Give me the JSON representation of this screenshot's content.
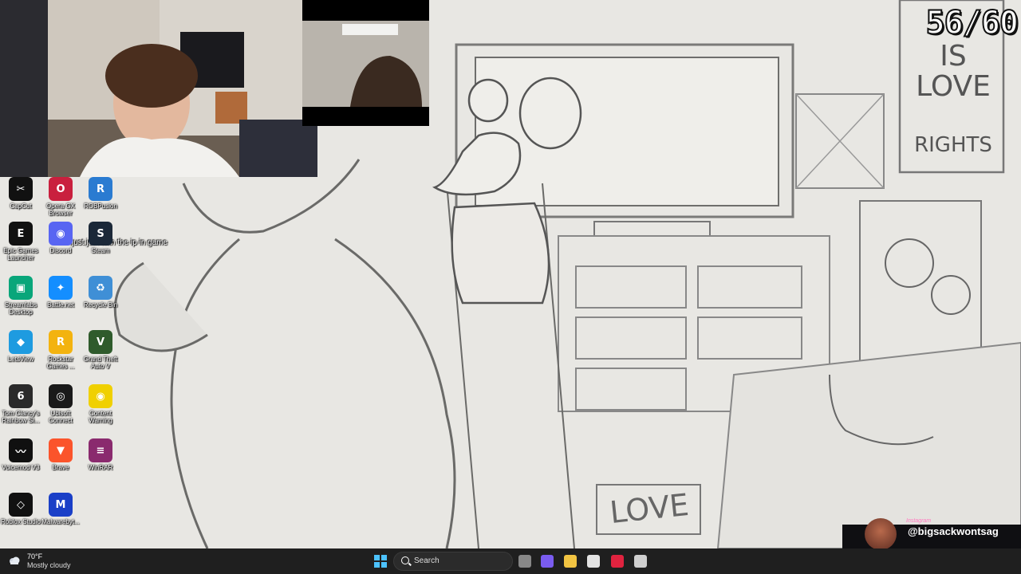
{
  "stream": {
    "counter": "56/60"
  },
  "chat": {
    "message": "just join with the ip in game"
  },
  "drawing": {
    "poster_lines": [
      "IS",
      "LOVE",
      "RIGHTS"
    ],
    "sign_text": "LOVE"
  },
  "desktop": {
    "icons": [
      {
        "label": "CapCut",
        "icon": "capcut-icon",
        "color": "#111111",
        "glyph": "✂"
      },
      {
        "label": "Opera GX Browser",
        "icon": "opera-gx-icon",
        "color": "#c9203e",
        "glyph": "O"
      },
      {
        "label": "ROBPusion",
        "icon": "robpusion-icon",
        "color": "#2a7bd1",
        "glyph": "R"
      },
      {
        "label": "Epic Games Launcher",
        "icon": "epic-games-icon",
        "color": "#111111",
        "glyph": "E"
      },
      {
        "label": "Discord",
        "icon": "discord-icon",
        "color": "#5865f2",
        "glyph": "◉"
      },
      {
        "label": "Steam",
        "icon": "steam-icon",
        "color": "#1b2838",
        "glyph": "S"
      },
      {
        "label": "Streamlabs Desktop",
        "icon": "streamlabs-icon",
        "color": "#09a67a",
        "glyph": "▣"
      },
      {
        "label": "Battle.net",
        "icon": "battlenet-icon",
        "color": "#148eff",
        "glyph": "✦"
      },
      {
        "label": "Recycle Bin",
        "icon": "recycle-bin-icon",
        "color": "#3f8fd6",
        "glyph": "♻"
      },
      {
        "label": "LetsView",
        "icon": "letsview-icon",
        "color": "#1e9be0",
        "glyph": "◆"
      },
      {
        "label": "Rockstar Games ...",
        "icon": "rockstar-icon",
        "color": "#f3b30f",
        "glyph": "R"
      },
      {
        "label": "Grand Theft Auto V",
        "icon": "gta-v-icon",
        "color": "#2f5b2c",
        "glyph": "V"
      },
      {
        "label": "Tom Clancy's Rainbow Si...",
        "icon": "rainbow-six-icon",
        "color": "#2a2a2a",
        "glyph": "6"
      },
      {
        "label": "Ubisoft Connect",
        "icon": "ubisoft-icon",
        "color": "#1a1a1a",
        "glyph": "◎"
      },
      {
        "label": "Content Warning",
        "icon": "content-warning-icon",
        "color": "#f0d000",
        "glyph": "◉"
      },
      {
        "label": "Voicemod V3",
        "icon": "voicemod-icon",
        "color": "#101010",
        "glyph": "〰"
      },
      {
        "label": "Brave",
        "icon": "brave-icon",
        "color": "#fb542b",
        "glyph": "▼"
      },
      {
        "label": "WinRAR",
        "icon": "winrar-icon",
        "color": "#8a2a6e",
        "glyph": "≡"
      },
      {
        "label": "Roblox Studio",
        "icon": "roblox-studio-icon",
        "color": "#111111",
        "glyph": "◇"
      },
      {
        "label": "Malwarebyt...",
        "icon": "malwarebytes-icon",
        "color": "#1a3fc7",
        "glyph": "M"
      }
    ]
  },
  "overlay": {
    "social_tag": "Instagram",
    "social_handle": "@bigsackwontsag"
  },
  "taskbar": {
    "weather_temp": "70°F",
    "weather_condition": "Mostly cloudy",
    "search_placeholder": "Search",
    "apps": [
      {
        "name": "task-view-icon",
        "color": "#888888"
      },
      {
        "name": "copilot-icon",
        "color": "#7a5cf0"
      },
      {
        "name": "file-explorer-icon",
        "color": "#f2c442"
      },
      {
        "name": "microsoft-store-icon",
        "color": "#e3e3e3"
      },
      {
        "name": "opera-gx-taskbar-icon",
        "color": "#e0233f"
      },
      {
        "name": "obs-icon",
        "color": "#cfcfcf"
      }
    ]
  }
}
